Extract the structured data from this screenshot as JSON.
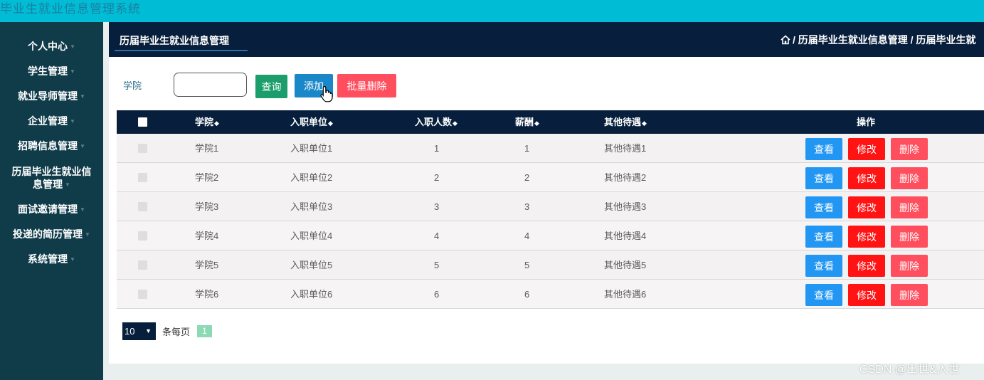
{
  "app": {
    "title": "毕业生就业信息管理系统"
  },
  "sidebar": {
    "items": [
      {
        "label": "个人中心"
      },
      {
        "label": "学生管理"
      },
      {
        "label": "就业导师管理"
      },
      {
        "label": "企业管理"
      },
      {
        "label": "招聘信息管理"
      },
      {
        "label_line1": "历届毕业生就业信",
        "label_line2": "息管理"
      },
      {
        "label": "面试邀请管理"
      },
      {
        "label": "投递的简历管理"
      },
      {
        "label": "系统管理"
      }
    ]
  },
  "header": {
    "title": "历届毕业生就业信息管理",
    "breadcrumb": "/ 历届毕业生就业信息管理 / 历届毕业生就"
  },
  "search": {
    "label": "学院",
    "value": "",
    "query_label": "查询",
    "add_label": "添加",
    "batch_delete_label": "批量删除"
  },
  "table": {
    "columns": [
      "学院",
      "入职单位",
      "入职人数",
      "薪酬",
      "其他待遇",
      "操作"
    ],
    "sort_glyph": "◆",
    "rows": [
      {
        "college": "学院1",
        "employer": "入职单位1",
        "count": "1",
        "salary": "1",
        "benefits": "其他待遇1"
      },
      {
        "college": "学院2",
        "employer": "入职单位2",
        "count": "2",
        "salary": "2",
        "benefits": "其他待遇2"
      },
      {
        "college": "学院3",
        "employer": "入职单位3",
        "count": "3",
        "salary": "3",
        "benefits": "其他待遇3"
      },
      {
        "college": "学院4",
        "employer": "入职单位4",
        "count": "4",
        "salary": "4",
        "benefits": "其他待遇4"
      },
      {
        "college": "学院5",
        "employer": "入职单位5",
        "count": "5",
        "salary": "5",
        "benefits": "其他待遇5"
      },
      {
        "college": "学院6",
        "employer": "入职单位6",
        "count": "6",
        "salary": "6",
        "benefits": "其他待遇6"
      }
    ],
    "actions": {
      "view": "查看",
      "edit": "修改",
      "delete": "删除"
    }
  },
  "pager": {
    "page_size": "10",
    "per_page_label": "条每页",
    "current_page": "1"
  },
  "watermark": "CSDN @出世&入世",
  "colors": {
    "topbar": "#00bcd4",
    "sidebar": "#103c4a",
    "header": "#071f3c",
    "query": "#1b9e6b",
    "add": "#1a87c9",
    "batch_delete": "#ff4f5e",
    "view": "#2196f3",
    "edit": "#ff1313",
    "delete": "#ff4f5e"
  },
  "icons": {
    "home": "home-icon",
    "dropdown": "caret-down-icon",
    "cursor": "hand-cursor-icon"
  }
}
